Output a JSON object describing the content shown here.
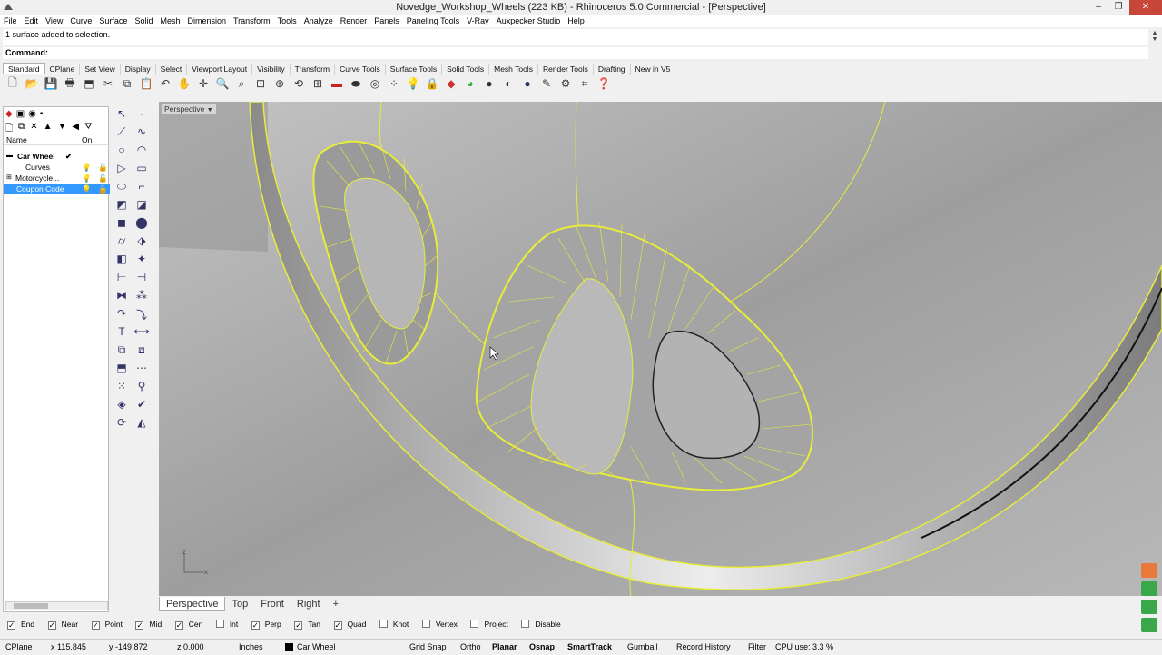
{
  "window": {
    "title": "Novedge_Workshop_Wheels (223 KB) - Rhinoceros 5.0 Commercial - [Perspective]",
    "min_label": "–",
    "max_label": "❐",
    "close_label": "✕"
  },
  "menu": [
    "File",
    "Edit",
    "View",
    "Curve",
    "Surface",
    "Solid",
    "Mesh",
    "Dimension",
    "Transform",
    "Tools",
    "Analyze",
    "Render",
    "Panels",
    "Paneling Tools",
    "V-Ray",
    "Auxpecker Studio",
    "Help"
  ],
  "command": {
    "history": "1 surface added to selection.",
    "prompt": "Command:"
  },
  "toolbar_tabs": [
    "Standard",
    "CPlane",
    "Set View",
    "Display",
    "Select",
    "Viewport Layout",
    "Visibility",
    "Transform",
    "Curve Tools",
    "Surface Tools",
    "Solid Tools",
    "Mesh Tools",
    "Render Tools",
    "Drafting",
    "New in V5"
  ],
  "layers": {
    "col_name": "Name",
    "col_on": "On",
    "rows": [
      {
        "name": "Car Wheel",
        "check": "✔"
      },
      {
        "name": "Curves"
      },
      {
        "name": "Motorcycle..."
      },
      {
        "name": "Coupon Code"
      }
    ]
  },
  "viewport": {
    "label": "Perspective",
    "axis_x": "x",
    "axis_z": "z"
  },
  "viewport_tabs": [
    "Perspective",
    "Top",
    "Front",
    "Right",
    "+"
  ],
  "osnaps": [
    {
      "label": "End",
      "checked": true
    },
    {
      "label": "Near",
      "checked": true
    },
    {
      "label": "Point",
      "checked": true
    },
    {
      "label": "Mid",
      "checked": true
    },
    {
      "label": "Cen",
      "checked": true
    },
    {
      "label": "Int",
      "checked": false
    },
    {
      "label": "Perp",
      "checked": true
    },
    {
      "label": "Tan",
      "checked": true
    },
    {
      "label": "Quad",
      "checked": true
    },
    {
      "label": "Knot",
      "checked": false
    },
    {
      "label": "Vertex",
      "checked": false
    },
    {
      "label": "Project",
      "checked": false
    },
    {
      "label": "Disable",
      "checked": false
    }
  ],
  "status": {
    "cplane": "CPlane",
    "x": "x 115.845",
    "y": "y -149.872",
    "z": "z 0.000",
    "units": "Inches",
    "layer": "Car Wheel",
    "grid_snap": "Grid Snap",
    "ortho": "Ortho",
    "planar": "Planar",
    "osnap": "Osnap",
    "smarttrack": "SmartTrack",
    "gumball": "Gumball",
    "record_history": "Record History",
    "filter": "Filter",
    "cpu": "CPU use: 3.3 %"
  },
  "colors": {
    "selection_yellow": "#e8ec3a",
    "layer_highlight": "#3399ff"
  }
}
